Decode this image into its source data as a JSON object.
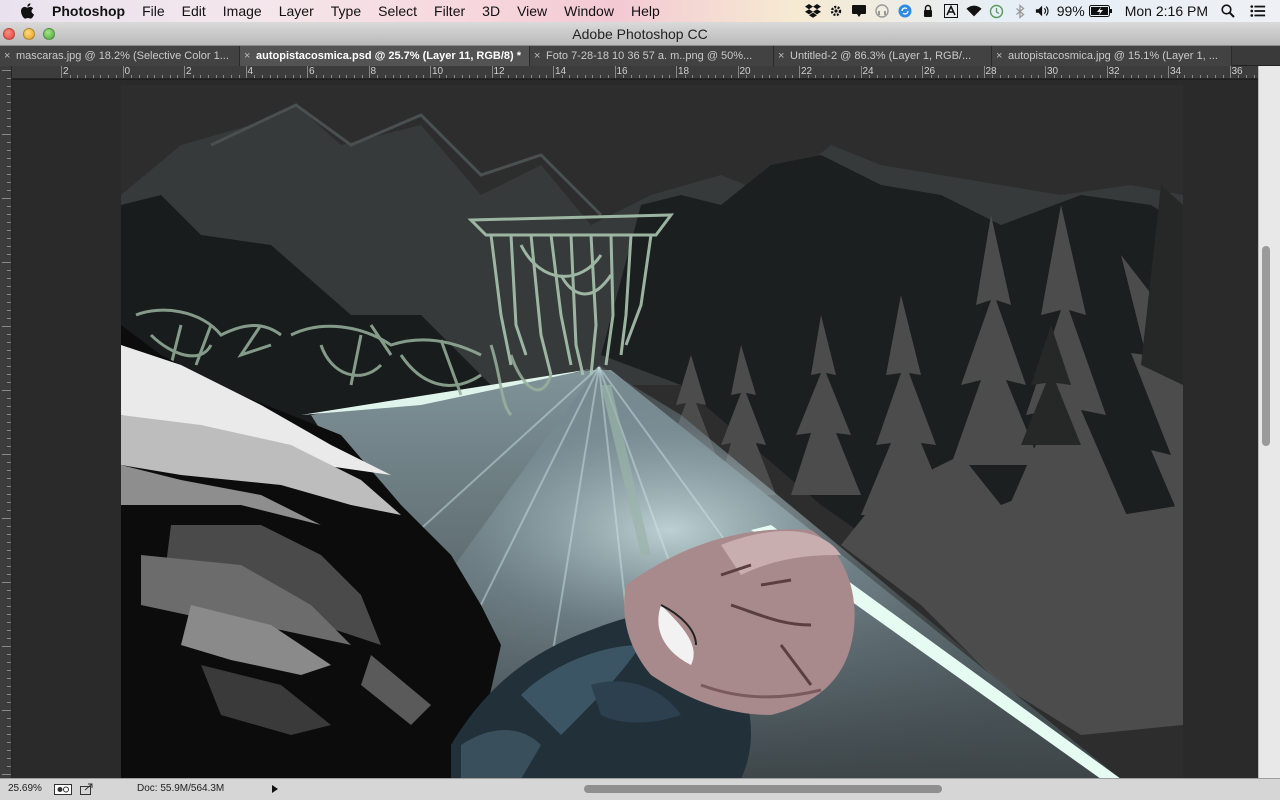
{
  "menubar": {
    "apple_icon": "apple-logo-icon",
    "items": [
      "Photoshop",
      "File",
      "Edit",
      "Image",
      "Layer",
      "Type",
      "Select",
      "Filter",
      "3D",
      "View",
      "Window",
      "Help"
    ],
    "status": {
      "icons": [
        "dropbox-icon",
        "settings-icon",
        "notifications-icon",
        "headphones-icon",
        "sync-icon",
        "keychain-icon",
        "adobe-icon",
        "wifi-icon",
        "time-machine-icon",
        "bluetooth-icon",
        "volume-icon"
      ],
      "battery": "99%",
      "battery_icon": "battery-icon",
      "clock": "Mon 2:16 PM",
      "search_icon": "spotlight-search-icon",
      "list_icon": "notification-center-icon"
    }
  },
  "window": {
    "title": "Adobe Photoshop CC"
  },
  "tabs": [
    {
      "label": "mascaras.jpg @ 18.2% (Selective Color 1...",
      "active": false
    },
    {
      "label": "autopistacosmica.psd @ 25.7% (Layer 11, RGB/8) *",
      "active": true
    },
    {
      "label": "Foto 7-28-18 10 36 57 a. m..png @ 50%...",
      "active": false
    },
    {
      "label": "Untitled-2 @ 86.3% (Layer 1, RGB/...",
      "active": false
    },
    {
      "label": "autopistacosmica.jpg @ 15.1% (Layer 1, ...",
      "active": false
    }
  ],
  "ruler": {
    "labels": [
      "2",
      "0",
      "2",
      "4",
      "6",
      "8",
      "10",
      "12",
      "14",
      "16",
      "18",
      "20",
      "22",
      "24",
      "26",
      "28",
      "30",
      "32",
      "34",
      "36"
    ]
  },
  "statusbar": {
    "zoom": "25.69%",
    "doc": "Doc: 55.9M/564.3M"
  },
  "colors": {
    "sky": "#2c2c2c",
    "mountain": "#1a1d1d",
    "trees": "#4a4a4a",
    "road_glow": "#dff5ec",
    "face": "#a98a8c",
    "jacket": "#22303a"
  }
}
